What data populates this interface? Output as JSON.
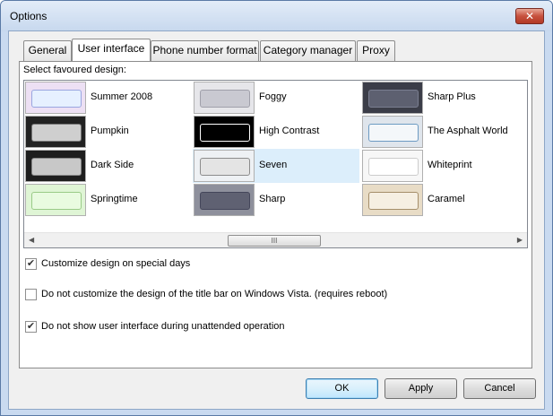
{
  "window": {
    "title": "Options",
    "close_glyph": "✕"
  },
  "tabs": [
    {
      "label": "General"
    },
    {
      "label": "User interface"
    },
    {
      "label": "Phone number format"
    },
    {
      "label": "Category manager"
    },
    {
      "label": "Proxy"
    }
  ],
  "active_tab": "User interface",
  "panel": {
    "designs_label": "Select favoured design:",
    "designs": [
      {
        "label": "Summer 2008",
        "thumb_bg": "#ede0f4",
        "inner_bg": "#e6f0ff",
        "inner_border": "#9aa6e0"
      },
      {
        "label": "Foggy",
        "thumb_bg": "#e6e6ea",
        "inner_bg": "#c9c9d1",
        "inner_border": "#a0a0aa"
      },
      {
        "label": "Sharp Plus",
        "thumb_bg": "#3b3d48",
        "inner_bg": "#5d6070",
        "inner_border": "#7a7e90"
      },
      {
        "label": "Pumpkin",
        "thumb_bg": "#222222",
        "inner_bg": "#cfcfcf",
        "inner_border": "#777777"
      },
      {
        "label": "High Contrast",
        "thumb_bg": "#000000",
        "inner_bg": "#000000",
        "inner_border": "#ffffff"
      },
      {
        "label": "The Asphalt World",
        "thumb_bg": "#dfe5ec",
        "inner_bg": "#f4f7fa",
        "inner_border": "#6d9bc3"
      },
      {
        "label": "Dark Side",
        "thumb_bg": "#1e1e1e",
        "inner_bg": "#c8c8c8",
        "inner_border": "#888888"
      },
      {
        "label": "Seven",
        "thumb_bg": "#eef1f4",
        "inner_bg": "#e4e4e4",
        "inner_border": "#8c8c8c"
      },
      {
        "label": "Whiteprint",
        "thumb_bg": "#f7f7f7",
        "inner_bg": "#ffffff",
        "inner_border": "#cccccc"
      },
      {
        "label": "Springtime",
        "thumb_bg": "#dff5d5",
        "inner_bg": "#e9fbe0",
        "inner_border": "#9acb87"
      },
      {
        "label": "Sharp",
        "thumb_bg": "#8e909c",
        "inner_bg": "#5f6172",
        "inner_border": "#44465a"
      },
      {
        "label": "Caramel",
        "thumb_bg": "#e8dcc6",
        "inner_bg": "#f6efe2",
        "inner_border": "#a58e6a"
      }
    ],
    "selected_design": "Seven",
    "scroll_left_glyph": "◀",
    "scroll_right_glyph": "▶",
    "scroll_grip": "III"
  },
  "options": [
    {
      "label": "Customize design on special days",
      "checked": true
    },
    {
      "label": "Do not customize the design of the title bar on Windows Vista. (requires reboot)",
      "checked": false
    },
    {
      "label": "Do not show user interface during unattended operation",
      "checked": true
    }
  ],
  "check_glyph": "✔",
  "buttons": {
    "ok": "OK",
    "apply": "Apply",
    "cancel": "Cancel"
  }
}
